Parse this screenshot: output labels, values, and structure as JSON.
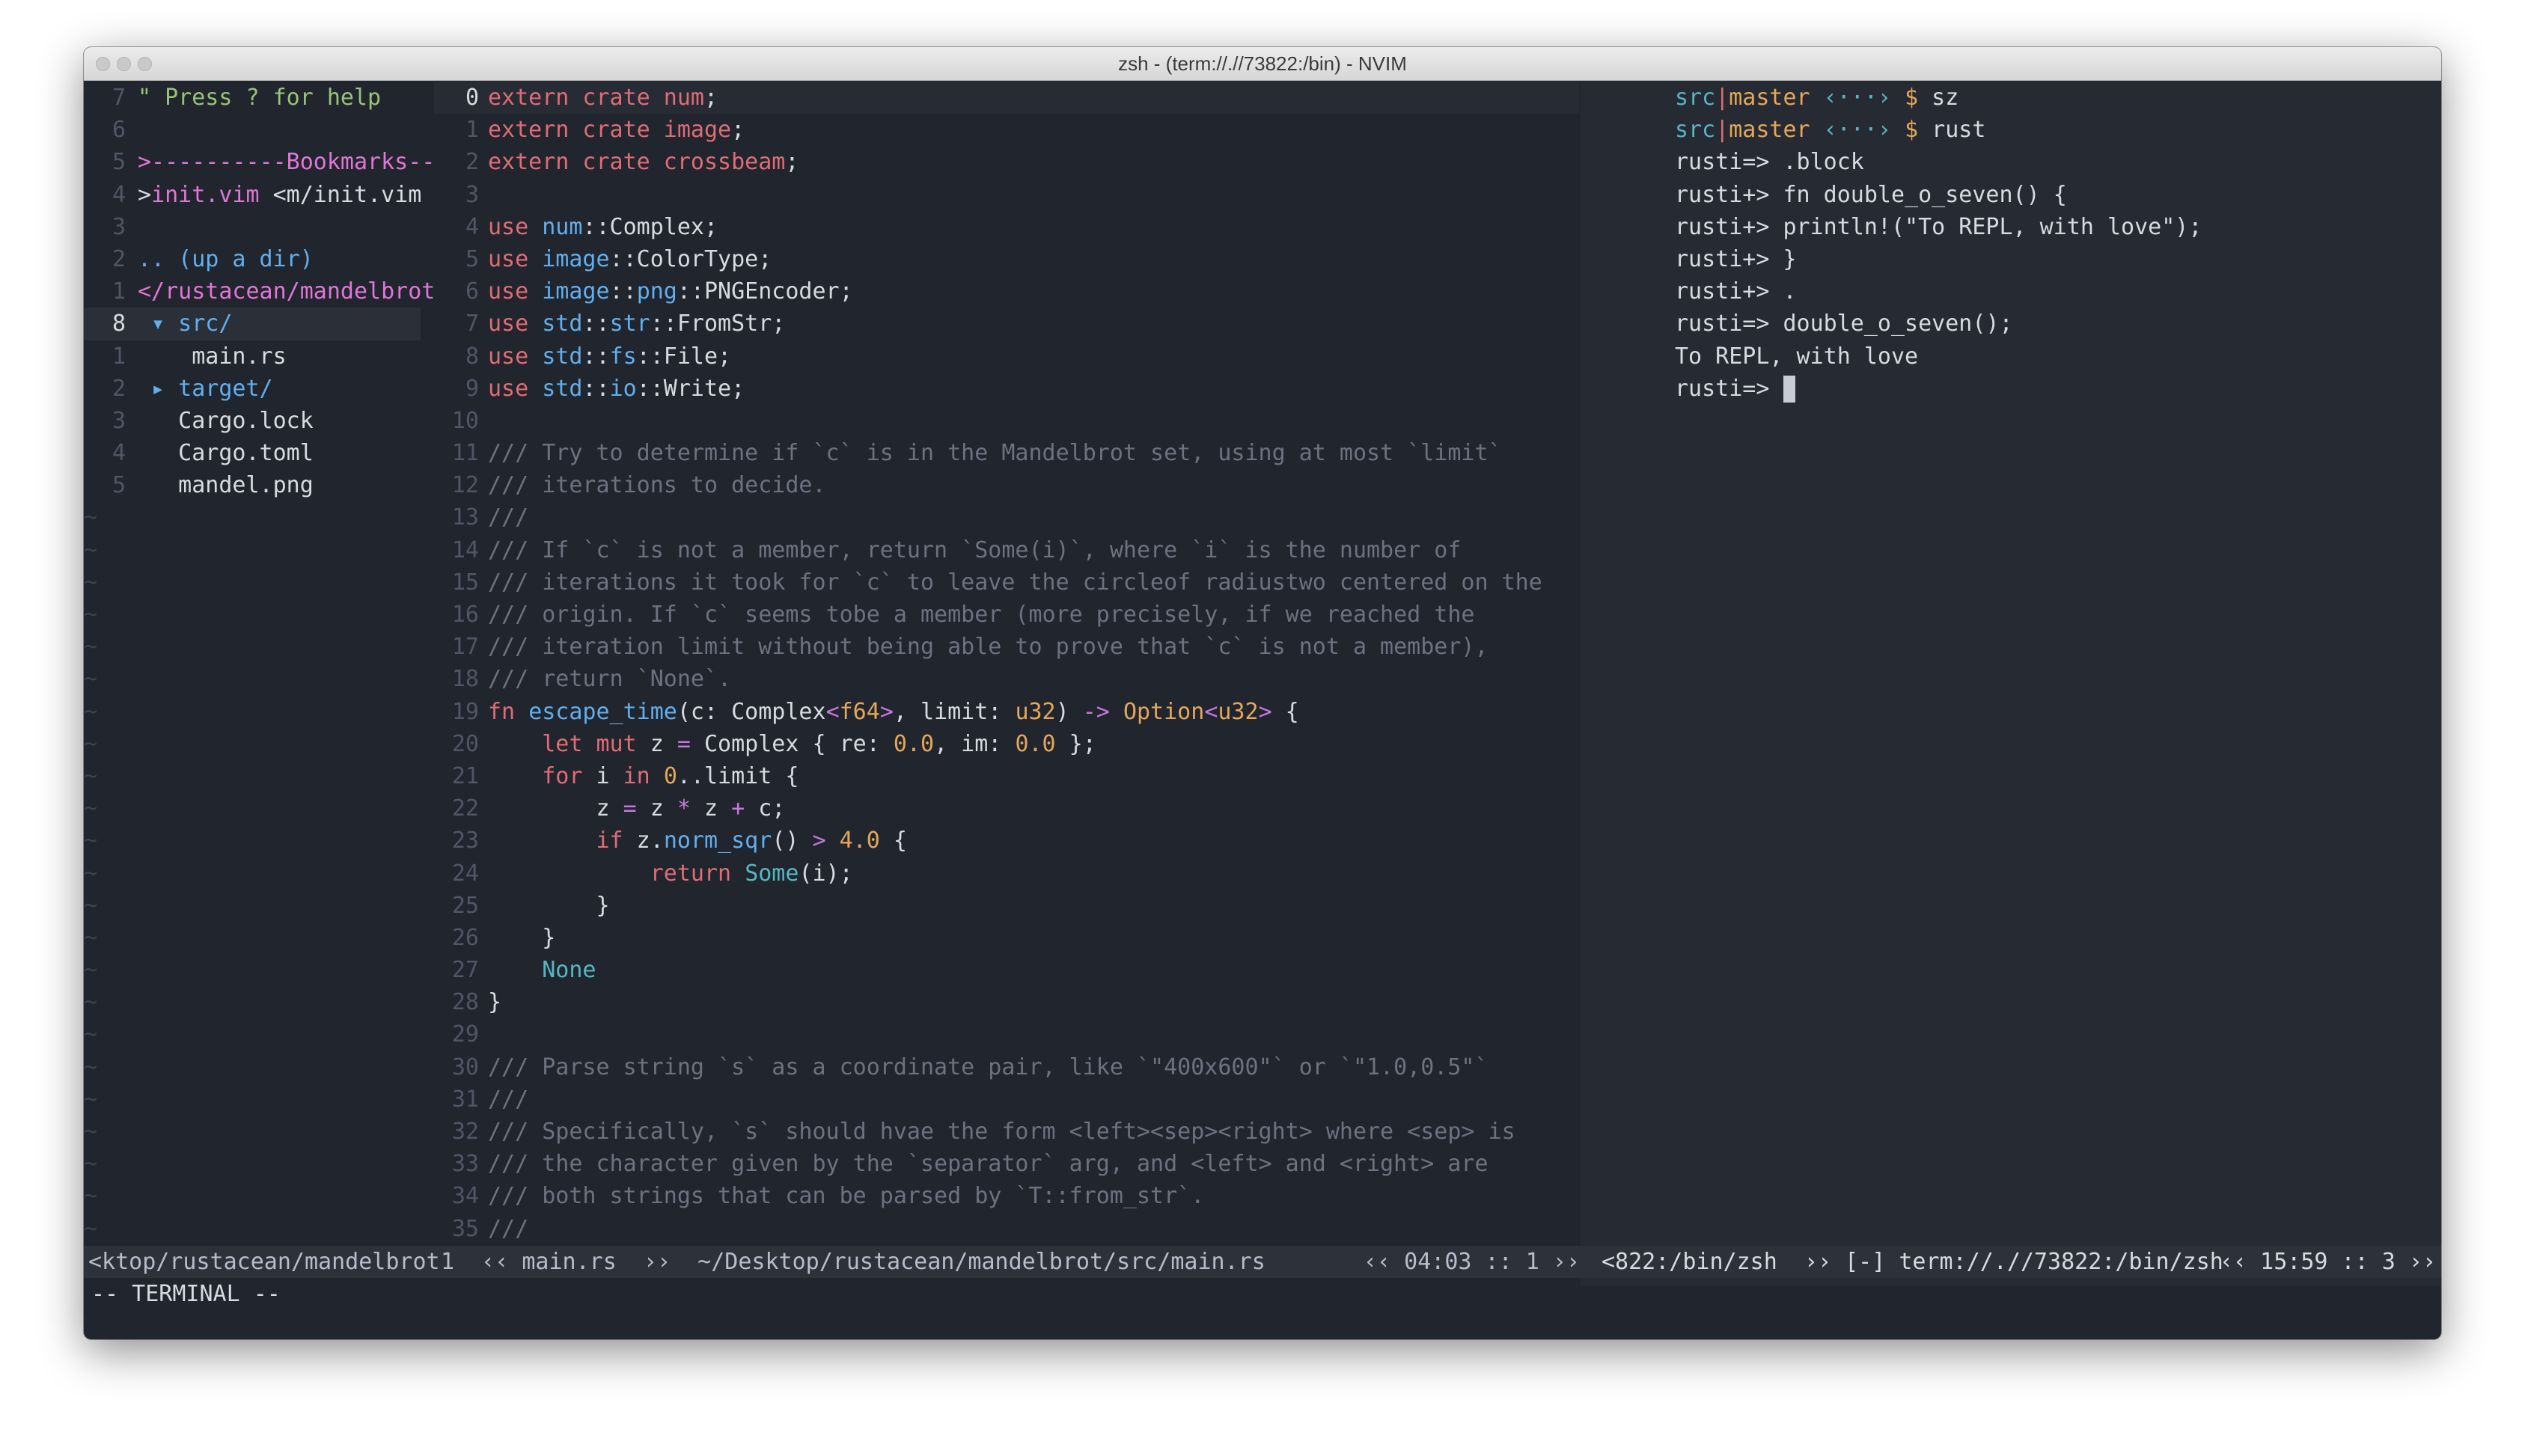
{
  "window": {
    "title": "zsh - (term://.//73822:/bin) - NVIM"
  },
  "colors": {
    "background": "#21252d",
    "keyword": "#e06c75",
    "type": "#61afef",
    "number": "#e5a65b",
    "comment": "#6b7280",
    "string_green": "#98c379",
    "accent_pink": "#e076d6",
    "teal": "#56b6c2"
  },
  "file_tree": {
    "lines": [
      {
        "num": "7",
        "current": false,
        "segs": [
          [
            "green",
            "\" Press ? for help"
          ]
        ]
      },
      {
        "num": "6",
        "current": false,
        "segs": []
      },
      {
        "num": "5",
        "current": false,
        "segs": [
          [
            "pink",
            ">----------Bookmarks--"
          ]
        ]
      },
      {
        "num": "4",
        "current": false,
        "segs": [
          [
            "default",
            ">"
          ],
          [
            "pink",
            "init.vim"
          ],
          [
            "default",
            " <m/init.vim"
          ]
        ]
      },
      {
        "num": "3",
        "current": false,
        "segs": []
      },
      {
        "num": "2",
        "current": false,
        "segs": [
          [
            "blue",
            ".. (up a dir)"
          ]
        ]
      },
      {
        "num": "1",
        "current": false,
        "segs": [
          [
            "pink",
            "</rustacean/mandelbrot"
          ]
        ]
      },
      {
        "num": "8",
        "current": true,
        "segs": [
          [
            "blue",
            " ▾ src/"
          ]
        ]
      },
      {
        "num": "1",
        "current": false,
        "segs": [
          [
            "default",
            "    main.rs"
          ]
        ]
      },
      {
        "num": "2",
        "current": false,
        "segs": [
          [
            "blue",
            " ▸ target/"
          ]
        ]
      },
      {
        "num": "3",
        "current": false,
        "segs": [
          [
            "default",
            "   Cargo.lock"
          ]
        ]
      },
      {
        "num": "4",
        "current": false,
        "segs": [
          [
            "default",
            "   Cargo.toml"
          ]
        ]
      },
      {
        "num": "5",
        "current": false,
        "segs": [
          [
            "default",
            "   mandel.png"
          ]
        ]
      }
    ],
    "filler": "~"
  },
  "editor": {
    "lines": [
      {
        "num": "0",
        "current": true,
        "segs": [
          [
            "kw",
            "extern crate num"
          ],
          [
            "default",
            ";"
          ]
        ]
      },
      {
        "num": "1",
        "current": false,
        "segs": [
          [
            "kw",
            "extern crate image"
          ],
          [
            "default",
            ";"
          ]
        ]
      },
      {
        "num": "2",
        "current": false,
        "segs": [
          [
            "kw",
            "extern crate crossbeam"
          ],
          [
            "default",
            ";"
          ]
        ]
      },
      {
        "num": "3",
        "current": false,
        "segs": []
      },
      {
        "num": "4",
        "current": false,
        "segs": [
          [
            "kw",
            "use "
          ],
          [
            "ty",
            "num"
          ],
          [
            "default",
            "::Complex;"
          ]
        ]
      },
      {
        "num": "5",
        "current": false,
        "segs": [
          [
            "kw",
            "use "
          ],
          [
            "ty",
            "image"
          ],
          [
            "default",
            "::ColorType;"
          ]
        ]
      },
      {
        "num": "6",
        "current": false,
        "segs": [
          [
            "kw",
            "use "
          ],
          [
            "ty",
            "image"
          ],
          [
            "default",
            "::"
          ],
          [
            "ty",
            "png"
          ],
          [
            "default",
            "::PNGEncoder;"
          ]
        ]
      },
      {
        "num": "7",
        "current": false,
        "segs": [
          [
            "kw",
            "use "
          ],
          [
            "ty",
            "std"
          ],
          [
            "default",
            "::"
          ],
          [
            "ty",
            "str"
          ],
          [
            "default",
            "::FromStr;"
          ]
        ]
      },
      {
        "num": "8",
        "current": false,
        "segs": [
          [
            "kw",
            "use "
          ],
          [
            "ty",
            "std"
          ],
          [
            "default",
            "::"
          ],
          [
            "ty",
            "fs"
          ],
          [
            "default",
            "::File;"
          ]
        ]
      },
      {
        "num": "9",
        "current": false,
        "segs": [
          [
            "kw",
            "use "
          ],
          [
            "ty",
            "std"
          ],
          [
            "default",
            "::"
          ],
          [
            "ty",
            "io"
          ],
          [
            "default",
            "::Write;"
          ]
        ]
      },
      {
        "num": "10",
        "current": false,
        "segs": []
      },
      {
        "num": "11",
        "current": false,
        "segs": [
          [
            "cm",
            "/// Try to determine if `c` is in the Mandelbrot set, using at most `limit`"
          ]
        ]
      },
      {
        "num": "12",
        "current": false,
        "segs": [
          [
            "cm",
            "/// iterations to decide."
          ]
        ]
      },
      {
        "num": "13",
        "current": false,
        "segs": [
          [
            "cm",
            "///"
          ]
        ]
      },
      {
        "num": "14",
        "current": false,
        "segs": [
          [
            "cm",
            "/// If `c` is not a member, return `Some(i)`, where `i` is the number of"
          ]
        ]
      },
      {
        "num": "15",
        "current": false,
        "segs": [
          [
            "cm",
            "/// iterations it took for `c` to leave the circleof radiustwo centered on the"
          ]
        ]
      },
      {
        "num": "16",
        "current": false,
        "segs": [
          [
            "cm",
            "/// origin. If `c` seems tobe a member (more precisely, if we reached the"
          ]
        ]
      },
      {
        "num": "17",
        "current": false,
        "segs": [
          [
            "cm",
            "/// iteration limit without being able to prove that `c` is not a member),"
          ]
        ]
      },
      {
        "num": "18",
        "current": false,
        "segs": [
          [
            "cm",
            "/// return `None`."
          ]
        ]
      },
      {
        "num": "19",
        "current": false,
        "segs": [
          [
            "kw",
            "fn "
          ],
          [
            "fn",
            "escape_time"
          ],
          [
            "default",
            "(c: Complex"
          ],
          [
            "op",
            "<"
          ],
          [
            "num",
            "f64"
          ],
          [
            "op",
            ">"
          ],
          [
            "default",
            ", limit: "
          ],
          [
            "num",
            "u32"
          ],
          [
            "default",
            ") "
          ],
          [
            "op",
            "->"
          ],
          [
            "default",
            " "
          ],
          [
            "num",
            "Option"
          ],
          [
            "op",
            "<"
          ],
          [
            "num",
            "u32"
          ],
          [
            "op",
            ">"
          ],
          [
            "default",
            " {"
          ]
        ]
      },
      {
        "num": "20",
        "current": false,
        "segs": [
          [
            "default",
            "    "
          ],
          [
            "kw",
            "let mut"
          ],
          [
            "default",
            " z "
          ],
          [
            "op",
            "="
          ],
          [
            "default",
            " Complex { re: "
          ],
          [
            "num",
            "0.0"
          ],
          [
            "default",
            ", im: "
          ],
          [
            "num",
            "0.0"
          ],
          [
            "default",
            " };"
          ]
        ]
      },
      {
        "num": "21",
        "current": false,
        "segs": [
          [
            "default",
            "    "
          ],
          [
            "kw",
            "for"
          ],
          [
            "default",
            " i "
          ],
          [
            "kw",
            "in"
          ],
          [
            "default",
            " "
          ],
          [
            "num",
            "0"
          ],
          [
            "default",
            "..limit {"
          ]
        ]
      },
      {
        "num": "22",
        "current": false,
        "segs": [
          [
            "default",
            "        z "
          ],
          [
            "op",
            "="
          ],
          [
            "default",
            " z "
          ],
          [
            "op",
            "*"
          ],
          [
            "default",
            " z "
          ],
          [
            "op",
            "+"
          ],
          [
            "default",
            " c;"
          ]
        ]
      },
      {
        "num": "23",
        "current": false,
        "segs": [
          [
            "default",
            "        "
          ],
          [
            "kw",
            "if"
          ],
          [
            "default",
            " z."
          ],
          [
            "fn",
            "norm_sqr"
          ],
          [
            "default",
            "() "
          ],
          [
            "op",
            ">"
          ],
          [
            "default",
            " "
          ],
          [
            "num",
            "4.0"
          ],
          [
            "default",
            " {"
          ]
        ]
      },
      {
        "num": "24",
        "current": false,
        "segs": [
          [
            "default",
            "            "
          ],
          [
            "kw",
            "return"
          ],
          [
            "default",
            " "
          ],
          [
            "ok",
            "Some"
          ],
          [
            "default",
            "(i);"
          ]
        ]
      },
      {
        "num": "25",
        "current": false,
        "segs": [
          [
            "default",
            "        }"
          ]
        ]
      },
      {
        "num": "26",
        "current": false,
        "segs": [
          [
            "default",
            "    }"
          ]
        ]
      },
      {
        "num": "27",
        "current": false,
        "segs": [
          [
            "default",
            "    "
          ],
          [
            "ok",
            "None"
          ]
        ]
      },
      {
        "num": "28",
        "current": false,
        "segs": [
          [
            "default",
            "}"
          ]
        ]
      },
      {
        "num": "29",
        "current": false,
        "segs": []
      },
      {
        "num": "30",
        "current": false,
        "segs": [
          [
            "cm",
            "/// Parse string `s` as a coordinate pair, like `\"400x600\"` or `\"1.0,0.5\"`"
          ]
        ]
      },
      {
        "num": "31",
        "current": false,
        "segs": [
          [
            "cm",
            "///"
          ]
        ]
      },
      {
        "num": "32",
        "current": false,
        "segs": [
          [
            "cm",
            "/// Specifically, `s` should hvae the form <left><sep><right> where <sep> is"
          ]
        ]
      },
      {
        "num": "33",
        "current": false,
        "segs": [
          [
            "cm",
            "/// the character given by the `separator` arg, and <left> and <right> are"
          ]
        ]
      },
      {
        "num": "34",
        "current": false,
        "segs": [
          [
            "cm",
            "/// both strings that can be parsed by `T::from_str`."
          ]
        ]
      },
      {
        "num": "35",
        "current": false,
        "segs": [
          [
            "cm",
            "///"
          ]
        ]
      }
    ]
  },
  "terminal": {
    "lines": [
      {
        "segs": [
          [
            "ok",
            "src"
          ],
          [
            "kw",
            "|"
          ],
          [
            "num",
            "master"
          ],
          [
            "default",
            " "
          ],
          [
            "ok",
            "‹···›"
          ],
          [
            "default",
            " "
          ],
          [
            "num",
            "$"
          ],
          [
            "default",
            " sz"
          ]
        ]
      },
      {
        "segs": [
          [
            "ok",
            "src"
          ],
          [
            "kw",
            "|"
          ],
          [
            "num",
            "master"
          ],
          [
            "default",
            " "
          ],
          [
            "ok",
            "‹···›"
          ],
          [
            "default",
            " "
          ],
          [
            "num",
            "$"
          ],
          [
            "default",
            " rust"
          ]
        ]
      },
      {
        "segs": [
          [
            "default",
            "rusti=> .block"
          ]
        ]
      },
      {
        "segs": [
          [
            "default",
            "rusti+> fn double_o_seven() {"
          ]
        ]
      },
      {
        "segs": [
          [
            "default",
            "rusti+> println!(\"To REPL, with love\");"
          ]
        ]
      },
      {
        "segs": [
          [
            "default",
            "rusti+> }"
          ]
        ]
      },
      {
        "segs": [
          [
            "default",
            "rusti+> ."
          ]
        ]
      },
      {
        "segs": [
          [
            "default",
            "rusti=> double_o_seven();"
          ]
        ]
      },
      {
        "segs": [
          [
            "default",
            "To REPL, with love"
          ]
        ]
      },
      {
        "segs": [
          [
            "default",
            "rusti=> "
          ]
        ],
        "cursor": true
      }
    ]
  },
  "statusline": {
    "tree_path": "<ktop/rustacean/mandelbrot",
    "editor_left": "1  ‹‹ main.rs  ››  ~/Desktop/rustacean/mandelbrot/src/main.rs",
    "editor_pos": "‹‹ 04:03 :: 1 ››",
    "term_left": "<822:/bin/zsh  ›› [-] term://.//73822:/bin/zsh",
    "term_pos": "‹‹ 15:59 :: 3 ››"
  },
  "cmdline": "-- TERMINAL --"
}
